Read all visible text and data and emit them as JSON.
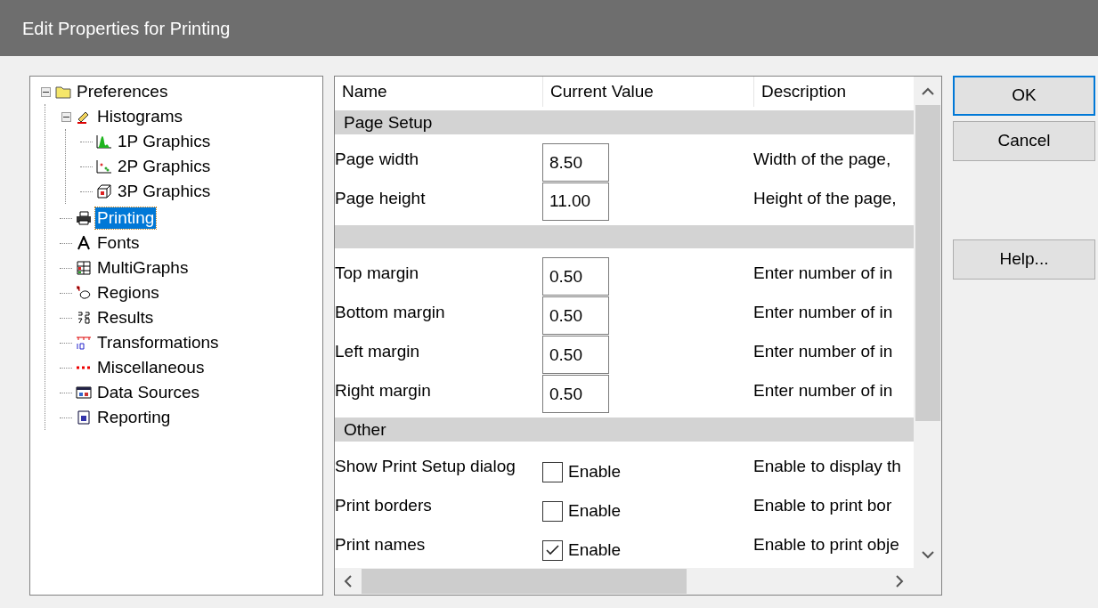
{
  "window": {
    "title": "Edit Properties for Printing"
  },
  "tree": [
    {
      "label": "Preferences",
      "expanded": true,
      "selected": false,
      "children": [
        {
          "label": "Histograms",
          "expanded": true,
          "selected": false,
          "children": [
            {
              "label": "1P Graphics",
              "selected": false
            },
            {
              "label": "2P Graphics",
              "selected": false
            },
            {
              "label": "3P Graphics",
              "selected": false
            }
          ]
        },
        {
          "label": "Printing",
          "selected": true
        },
        {
          "label": "Fonts",
          "selected": false
        },
        {
          "label": "MultiGraphs",
          "selected": false
        },
        {
          "label": "Regions",
          "selected": false
        },
        {
          "label": "Results",
          "selected": false
        },
        {
          "label": "Transformations",
          "selected": false
        },
        {
          "label": "Miscellaneous",
          "selected": false
        },
        {
          "label": "Data Sources",
          "selected": false
        },
        {
          "label": "Reporting",
          "selected": false
        }
      ]
    }
  ],
  "grid": {
    "columns": [
      "Name",
      "Current Value",
      "Description"
    ],
    "rows": [
      {
        "kind": "section",
        "label": "Page Setup"
      },
      {
        "kind": "number",
        "name": "Page width",
        "value": "8.50",
        "description": "Width of the page,"
      },
      {
        "kind": "number",
        "name": "Page height",
        "value": "11.00",
        "description": "Height of the page,"
      },
      {
        "kind": "section"
      },
      {
        "kind": "number",
        "name": "Top margin",
        "value": "0.50",
        "description": "Enter number of in"
      },
      {
        "kind": "number",
        "name": "Bottom margin",
        "value": "0.50",
        "description": "Enter number of in"
      },
      {
        "kind": "number",
        "name": "Left margin",
        "value": "0.50",
        "description": "Enter number of in"
      },
      {
        "kind": "number",
        "name": "Right margin",
        "value": "0.50",
        "description": "Enter number of in"
      },
      {
        "kind": "section",
        "label": "Other"
      },
      {
        "kind": "checkbox",
        "name": "Show Print Setup dialog",
        "checked": false,
        "option": "Enable",
        "description": "Enable to display th"
      },
      {
        "kind": "checkbox",
        "name": "Print borders",
        "checked": false,
        "option": "Enable",
        "description": "Enable to print bor"
      },
      {
        "kind": "checkbox",
        "name": "Print names",
        "checked": true,
        "option": "Enable",
        "description": "Enable to print obje"
      }
    ]
  },
  "buttons": [
    {
      "label": "OK",
      "default": true
    },
    {
      "label": "Cancel",
      "default": false
    },
    {
      "label": "Help...",
      "default": false
    }
  ]
}
